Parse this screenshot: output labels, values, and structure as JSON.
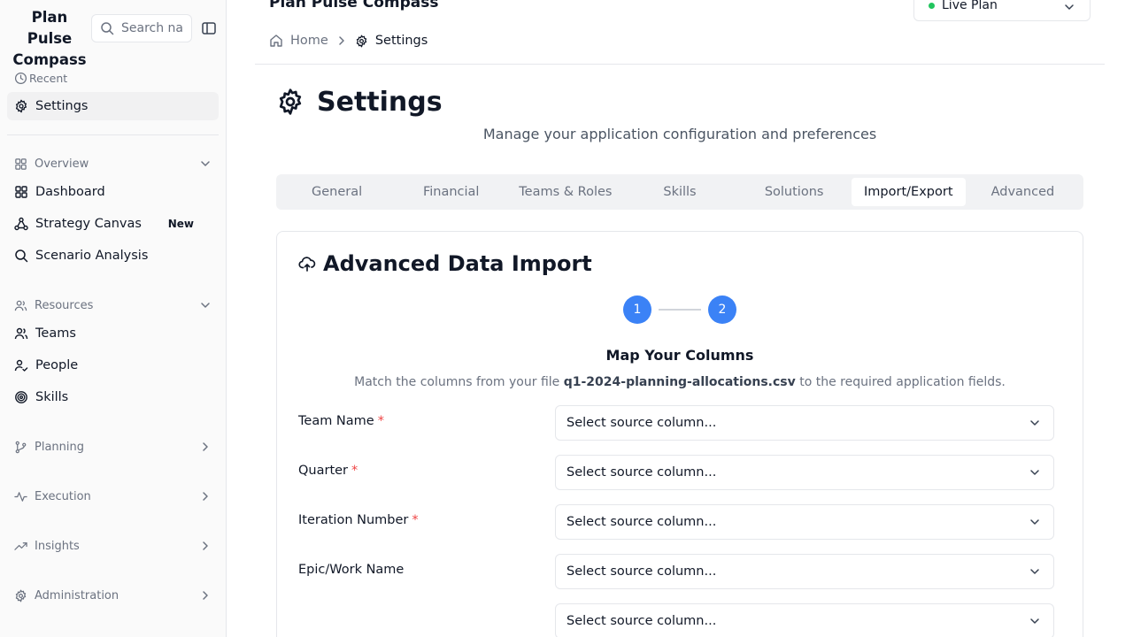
{
  "sidebar": {
    "brand": "Plan Pulse Compass",
    "search_placeholder": "Search na",
    "recent_label": "Recent",
    "recent_items": [
      {
        "label": "Settings",
        "icon": "gear-icon"
      }
    ],
    "groups": [
      {
        "label": "Overview",
        "expanded": true,
        "items": [
          {
            "label": "Dashboard",
            "icon": "layout-grid-icon"
          },
          {
            "label": "Strategy Canvas",
            "icon": "workflow-icon",
            "badge": "New"
          },
          {
            "label": "Scenario Analysis",
            "icon": "search-icon"
          }
        ]
      },
      {
        "label": "Resources",
        "expanded": true,
        "items": [
          {
            "label": "Teams",
            "icon": "users-icon"
          },
          {
            "label": "People",
            "icon": "user-check-icon"
          },
          {
            "label": "Skills",
            "icon": "target-icon"
          }
        ]
      },
      {
        "label": "Planning",
        "expanded": false,
        "icon": "git-branch-icon"
      },
      {
        "label": "Execution",
        "expanded": false,
        "icon": "activity-icon"
      },
      {
        "label": "Insights",
        "expanded": false,
        "icon": "trending-up-icon"
      },
      {
        "label": "Administration",
        "expanded": false,
        "icon": "gear-icon"
      }
    ]
  },
  "header": {
    "app_title": "Plan Pulse Compass",
    "plan_selector": {
      "value": "Live Plan",
      "status_color": "#22c55e"
    },
    "breadcrumb": [
      {
        "label": "Home"
      },
      {
        "label": "Settings"
      }
    ]
  },
  "page": {
    "title": "Settings",
    "subtitle": "Manage your application configuration and preferences",
    "tabs": [
      "General",
      "Financial",
      "Teams & Roles",
      "Skills",
      "Solutions",
      "Import/Export",
      "Advanced"
    ],
    "active_tab": "Import/Export"
  },
  "import": {
    "title": "Advanced Data Import",
    "steps": [
      "1",
      "2"
    ],
    "current_step": 2,
    "map_title": "Map Your Columns",
    "desc_prefix": "Match the columns from your file",
    "file_name": "q1-2024-planning-allocations.csv",
    "desc_suffix": "to the required application fields.",
    "fields": [
      {
        "label": "Team Name",
        "required": "*",
        "placeholder": "Select source column..."
      },
      {
        "label": "Quarter",
        "required": "*",
        "placeholder": "Select source column..."
      },
      {
        "label": "Iteration Number",
        "required": "*",
        "placeholder": "Select source column..."
      },
      {
        "label": "Epic/Work Name",
        "required": "",
        "placeholder": "Select source column..."
      },
      {
        "label": "",
        "required": "",
        "placeholder": "Select source column..."
      }
    ]
  },
  "colors": {
    "accent": "#3b82f6",
    "required": "#ef4444",
    "status_live": "#22c55e"
  }
}
